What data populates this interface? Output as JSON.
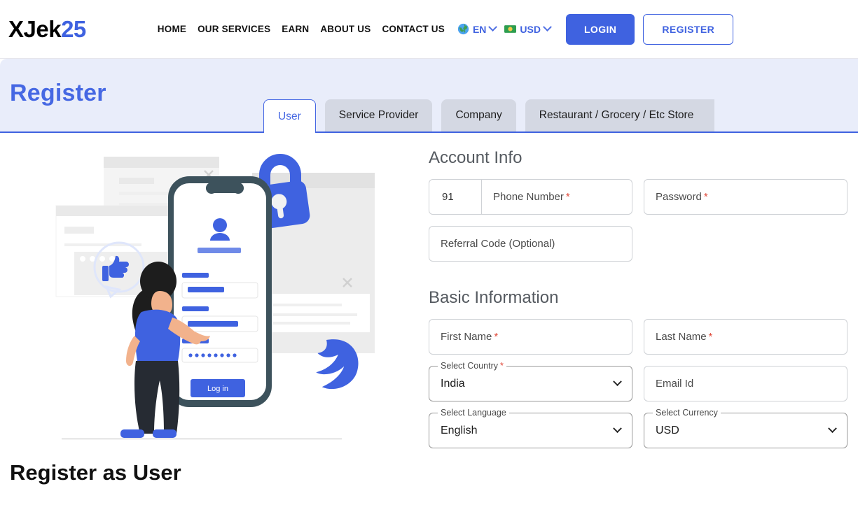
{
  "header": {
    "logo": {
      "dark": "XJek",
      "accent": "25"
    },
    "nav": [
      {
        "label": "HOME"
      },
      {
        "label": "OUR SERVICES"
      },
      {
        "label": "EARN"
      },
      {
        "label": "ABOUT US"
      },
      {
        "label": "CONTACT US"
      }
    ],
    "language_selector": {
      "icon": "globe-icon",
      "value": "EN"
    },
    "currency_selector": {
      "icon": "money-icon",
      "value": "USD"
    },
    "login_label": "LOGIN",
    "register_label": "REGISTER",
    "accent_color": "#3f62e0"
  },
  "banner": {
    "title": "Register",
    "background_color": "#e9edfa",
    "border_color": "#3f62e0",
    "tabs": [
      {
        "label": "User",
        "active": true
      },
      {
        "label": "Service Provider",
        "active": false
      },
      {
        "label": "Company",
        "active": false
      },
      {
        "label": "Restaurant / Grocery / Etc Store",
        "active": false
      }
    ]
  },
  "left": {
    "heading": "Register as User",
    "illustration": {
      "name": "register-illustration",
      "phone_login_button": "Log in"
    }
  },
  "form": {
    "account_info": {
      "title": "Account Info",
      "phone_code": "91",
      "phone_placeholder": "Phone Number",
      "phone_required": "*",
      "password_placeholder": "Password",
      "password_required": "*",
      "referral_placeholder": "Referral Code (Optional)"
    },
    "basic_information": {
      "title": "Basic Information",
      "first_name_placeholder": "First Name",
      "first_name_required": "*",
      "last_name_placeholder": "Last Name",
      "last_name_required": "*",
      "country_label": "Select Country",
      "country_required": "*",
      "country_value": "India",
      "email_placeholder": "Email Id",
      "language_label": "Select Language",
      "language_value": "English",
      "currency_label": "Select Currency",
      "currency_value": "USD"
    }
  }
}
